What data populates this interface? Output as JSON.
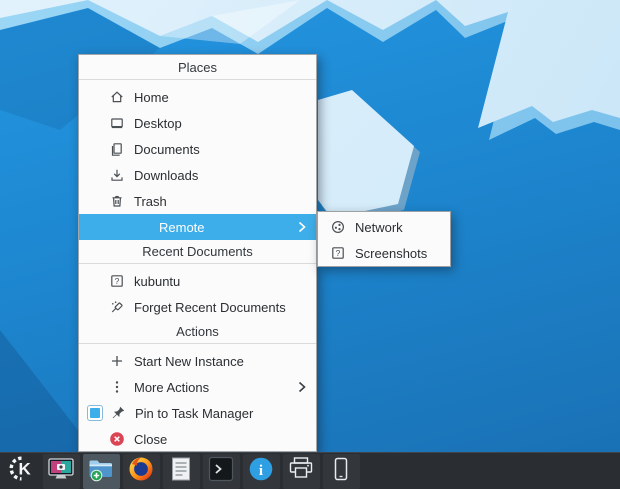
{
  "menu": {
    "sections": [
      {
        "title": "Places",
        "items": [
          {
            "icon": "home-icon",
            "label": "Home"
          },
          {
            "icon": "desktop-icon",
            "label": "Desktop"
          },
          {
            "icon": "documents-icon",
            "label": "Documents"
          },
          {
            "icon": "download-icon",
            "label": "Downloads"
          },
          {
            "icon": "trash-icon",
            "label": "Trash"
          },
          {
            "icon": "none",
            "label": "Remote",
            "has_submenu": true,
            "highlighted": true
          }
        ]
      },
      {
        "title": "Recent Documents",
        "items": [
          {
            "icon": "unknown-file-icon",
            "label": "kubuntu"
          },
          {
            "icon": "clear-history-icon",
            "label": "Forget Recent Documents"
          }
        ]
      },
      {
        "title": "Actions",
        "items": [
          {
            "icon": "plus-icon",
            "label": "Start New Instance"
          },
          {
            "icon": "more-actions-icon",
            "label": "More Actions",
            "has_submenu": true
          },
          {
            "icon": "pin-icon",
            "label": "Pin to Task Manager",
            "checked": true
          },
          {
            "icon": "close-icon",
            "label": "Close"
          }
        ]
      }
    ],
    "submenu": {
      "items": [
        {
          "icon": "network-icon",
          "label": "Network"
        },
        {
          "icon": "unknown-file-icon",
          "label": "Screenshots"
        }
      ]
    }
  },
  "taskbar": {
    "items": [
      {
        "icon": "kde-launcher-icon",
        "active": false
      },
      {
        "icon": "display-settings-icon",
        "active": false
      },
      {
        "icon": "dolphin-folder-icon",
        "active": true,
        "badge": "green-plus"
      },
      {
        "icon": "firefox-icon",
        "active": false
      },
      {
        "icon": "text-editor-icon",
        "active": false
      },
      {
        "icon": "terminal-icon",
        "active": false
      },
      {
        "icon": "info-icon",
        "active": false
      },
      {
        "icon": "printer-icon",
        "active": false
      },
      {
        "icon": "phone-icon",
        "active": false
      }
    ]
  },
  "colors": {
    "highlight": "#3daee9",
    "menu_background": "#fbfbfb",
    "menu_text": "#2b2f33",
    "close_red": "#da4453",
    "checkbox_blue": "#3daee9",
    "panel_background": "#2a2e32",
    "active_task_background": "#4d5760",
    "wallpaper_dark_blue": "#1d86cf",
    "wallpaper_light_blue": "#d2eaf9",
    "wallpaper_stripe_blue": "#8ccff2",
    "badge_green": "#23a455",
    "info_blue": "#2f9fe3"
  }
}
